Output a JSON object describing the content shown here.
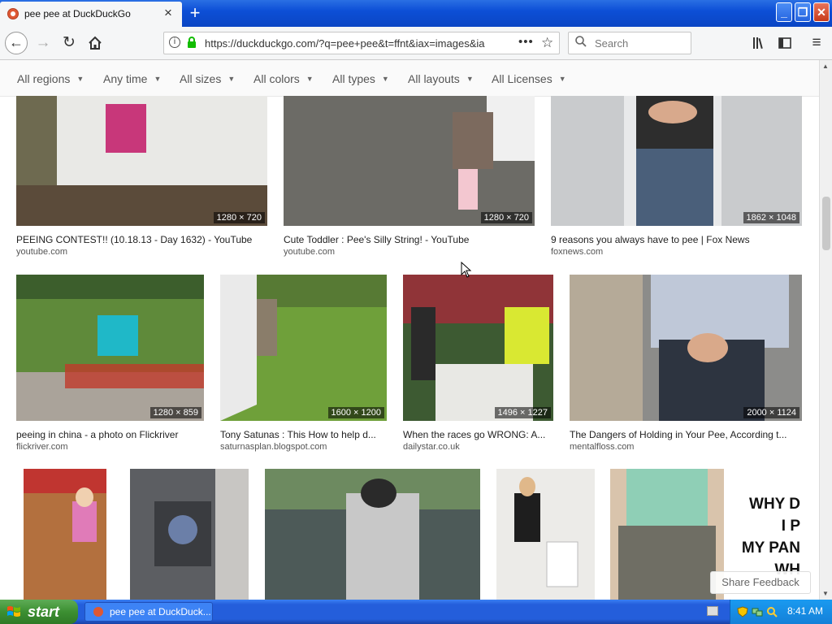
{
  "browser": {
    "tab_title": "pee pee at DuckDuckGo",
    "tab_close": "×",
    "new_tab": "+",
    "url": "https://duckduckgo.com/?q=pee+pee&t=ffnt&iax=images&ia",
    "search_placeholder": "Search",
    "window_buttons": [
      "_",
      "❐",
      "✕"
    ]
  },
  "filters": [
    {
      "label": "All regions"
    },
    {
      "label": "Any time"
    },
    {
      "label": "All sizes"
    },
    {
      "label": "All colors"
    },
    {
      "label": "All types"
    },
    {
      "label": "All layouts"
    },
    {
      "label": "All Licenses"
    }
  ],
  "results": [
    {
      "caption": "PEEING CONTEST!! (10.18.13 - Day 1632) - YouTube",
      "source": "youtube.com",
      "dims": "1280 × 720",
      "bg": "#7a7358"
    },
    {
      "caption": "Cute Toddler : Pee's Silly String! - YouTube",
      "source": "youtube.com",
      "dims": "1280 × 720",
      "bg": "#6f6c66"
    },
    {
      "caption": "9 reasons you always have to pee | Fox News",
      "source": "foxnews.com",
      "dims": "1862 × 1048",
      "bg": "#9aa0a6"
    },
    {
      "caption": "peeing in china - a photo on Flickriver",
      "source": "flickriver.com",
      "dims": "1280 × 859",
      "bg": "#5f8a3a"
    },
    {
      "caption": "Tony Satunas : This How to help d...",
      "source": "saturnasplan.blogspot.com",
      "dims": "1600 × 1200",
      "bg": "#6f9a3c"
    },
    {
      "caption": "When the races go WRONG: A...",
      "source": "dailystar.co.uk",
      "dims": "1496 × 1227",
      "bg": "#5a6848"
    },
    {
      "caption": "The Dangers of Holding in Your Pee, According t...",
      "source": "mentalfloss.com",
      "dims": "2000 × 1124",
      "bg": "#7d7f83"
    },
    {
      "caption": "",
      "source": "",
      "dims": "",
      "bg": "#b3703e"
    },
    {
      "caption": "",
      "source": "",
      "dims": "",
      "bg": "#5c5e62"
    },
    {
      "caption": "",
      "source": "",
      "dims": "",
      "bg": "#5b7a55"
    },
    {
      "caption": "",
      "source": "",
      "dims": "",
      "bg": "#e8e6e2"
    },
    {
      "caption": "",
      "source": "",
      "dims": "",
      "bg": "#a9c7a8",
      "overlay_text": "WHY D\nI P\nMY PAN\nWH"
    }
  ],
  "feedback_label": "Share Feedback",
  "taskbar": {
    "start_label": "start",
    "item_label": "pee pee at DuckDuck...",
    "clock": "8:41 AM"
  }
}
